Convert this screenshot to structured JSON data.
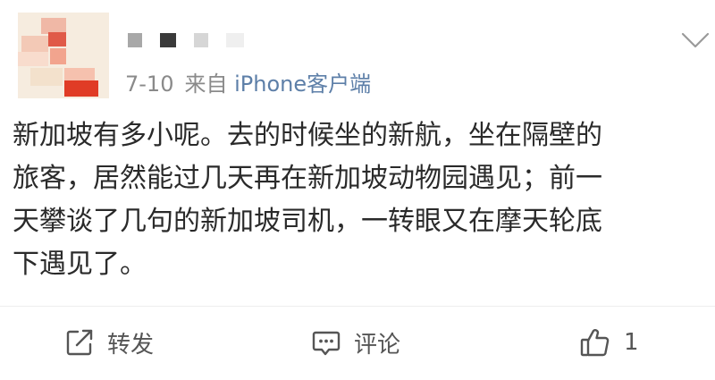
{
  "post": {
    "meta": {
      "date": "7-10",
      "source_prefix": "来自",
      "source_client": "iPhone客户端"
    },
    "content": "新加坡有多小呢。去的时候坐的新航，坐在隔壁的\n旅客，居然能过几天再在新加坡动物园遇见；前一\n天攀谈了几句的新加坡司机，一转眼又在摩天轮底\n下遇见了。"
  },
  "actions": {
    "repost_label": "转发",
    "comment_label": "评论",
    "like_count": "1"
  },
  "icons": {
    "repost": "repost-icon",
    "comment": "comment-icon",
    "like": "thumbs-up-icon",
    "menu": "chevron-down-icon"
  },
  "colors": {
    "text": "#2a2a2a",
    "meta": "#8a8a8a",
    "client_link": "#5d7fa8",
    "icon": "#555555"
  }
}
